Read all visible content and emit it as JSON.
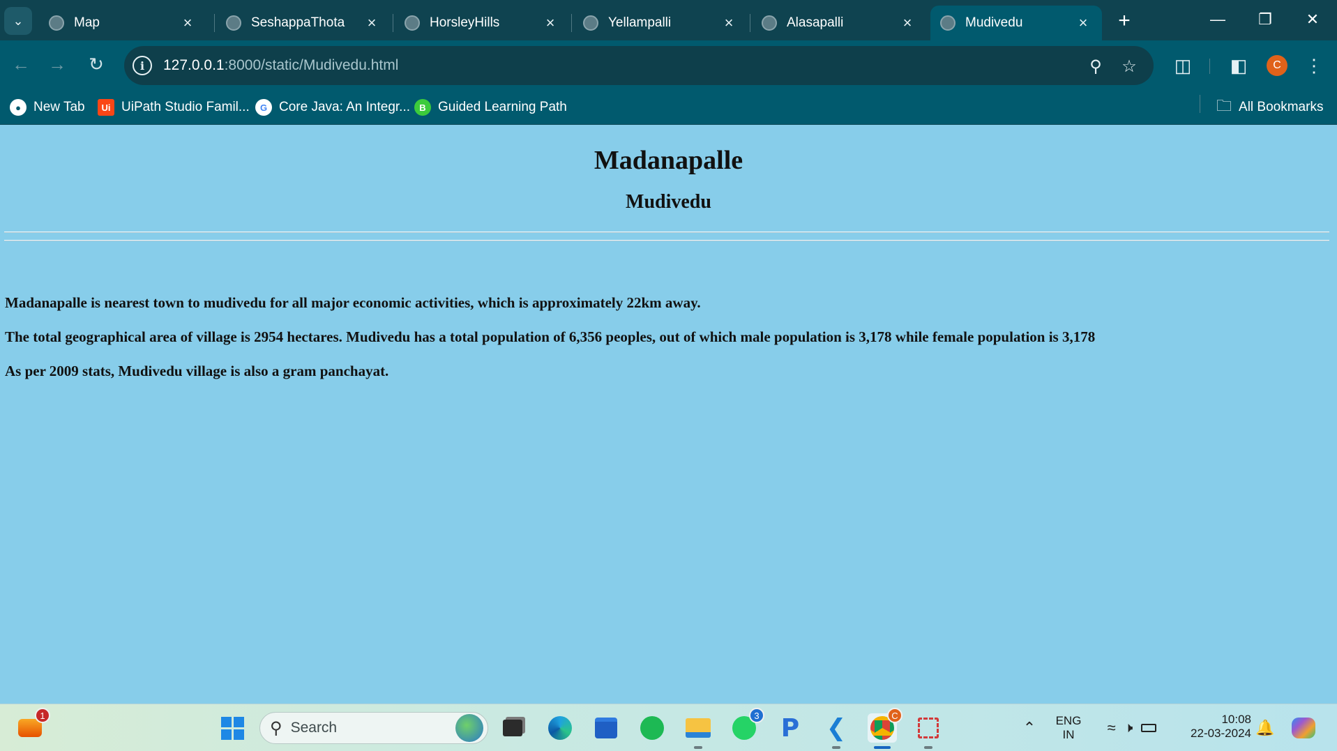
{
  "browser": {
    "tabs": [
      {
        "title": "Map",
        "active": false
      },
      {
        "title": "SeshappaThota",
        "active": false
      },
      {
        "title": "HorsleyHills",
        "active": false
      },
      {
        "title": "Yellampalli",
        "active": false
      },
      {
        "title": "Alasapalli",
        "active": false
      },
      {
        "title": "Mudivedu",
        "active": true
      }
    ],
    "url_host": "127.0.0.1",
    "url_path": ":8000/static/Mudivedu.html",
    "profile_initial": "C",
    "bookmarks": [
      {
        "label": "New Tab",
        "icon": "globe-icon"
      },
      {
        "label": "UiPath Studio Famil...",
        "icon": "uipath-icon",
        "glyph": "Ui"
      },
      {
        "label": "Core Java: An Integr...",
        "icon": "google-icon",
        "glyph": "G"
      },
      {
        "label": "Guided Learning Path",
        "icon": "b-icon",
        "glyph": "B"
      }
    ],
    "all_bookmarks": "All Bookmarks"
  },
  "page": {
    "heading": "Madanapalle",
    "subheading": "Mudivedu",
    "paragraphs": [
      "Madanapalle is nearest town to mudivedu for all major economic activities, which is approximately 22km away.",
      "The total geographical area of village is 2954 hectares. Mudivedu has a total population of 6,356 peoples, out of which male population is 3,178 while female population is 3,178",
      "As per 2009 stats, Mudivedu village is also a gram panchayat."
    ]
  },
  "taskbar": {
    "search_placeholder": "Search",
    "widgets_badge": "1",
    "whatsapp_badge": "3",
    "language_line1": "ENG",
    "language_line2": "IN",
    "time": "10:08",
    "date": "22-03-2024"
  },
  "colors": {
    "page_background": "#87cdea",
    "toolbar": "#015a6e",
    "tabbar": "#0f4350"
  }
}
